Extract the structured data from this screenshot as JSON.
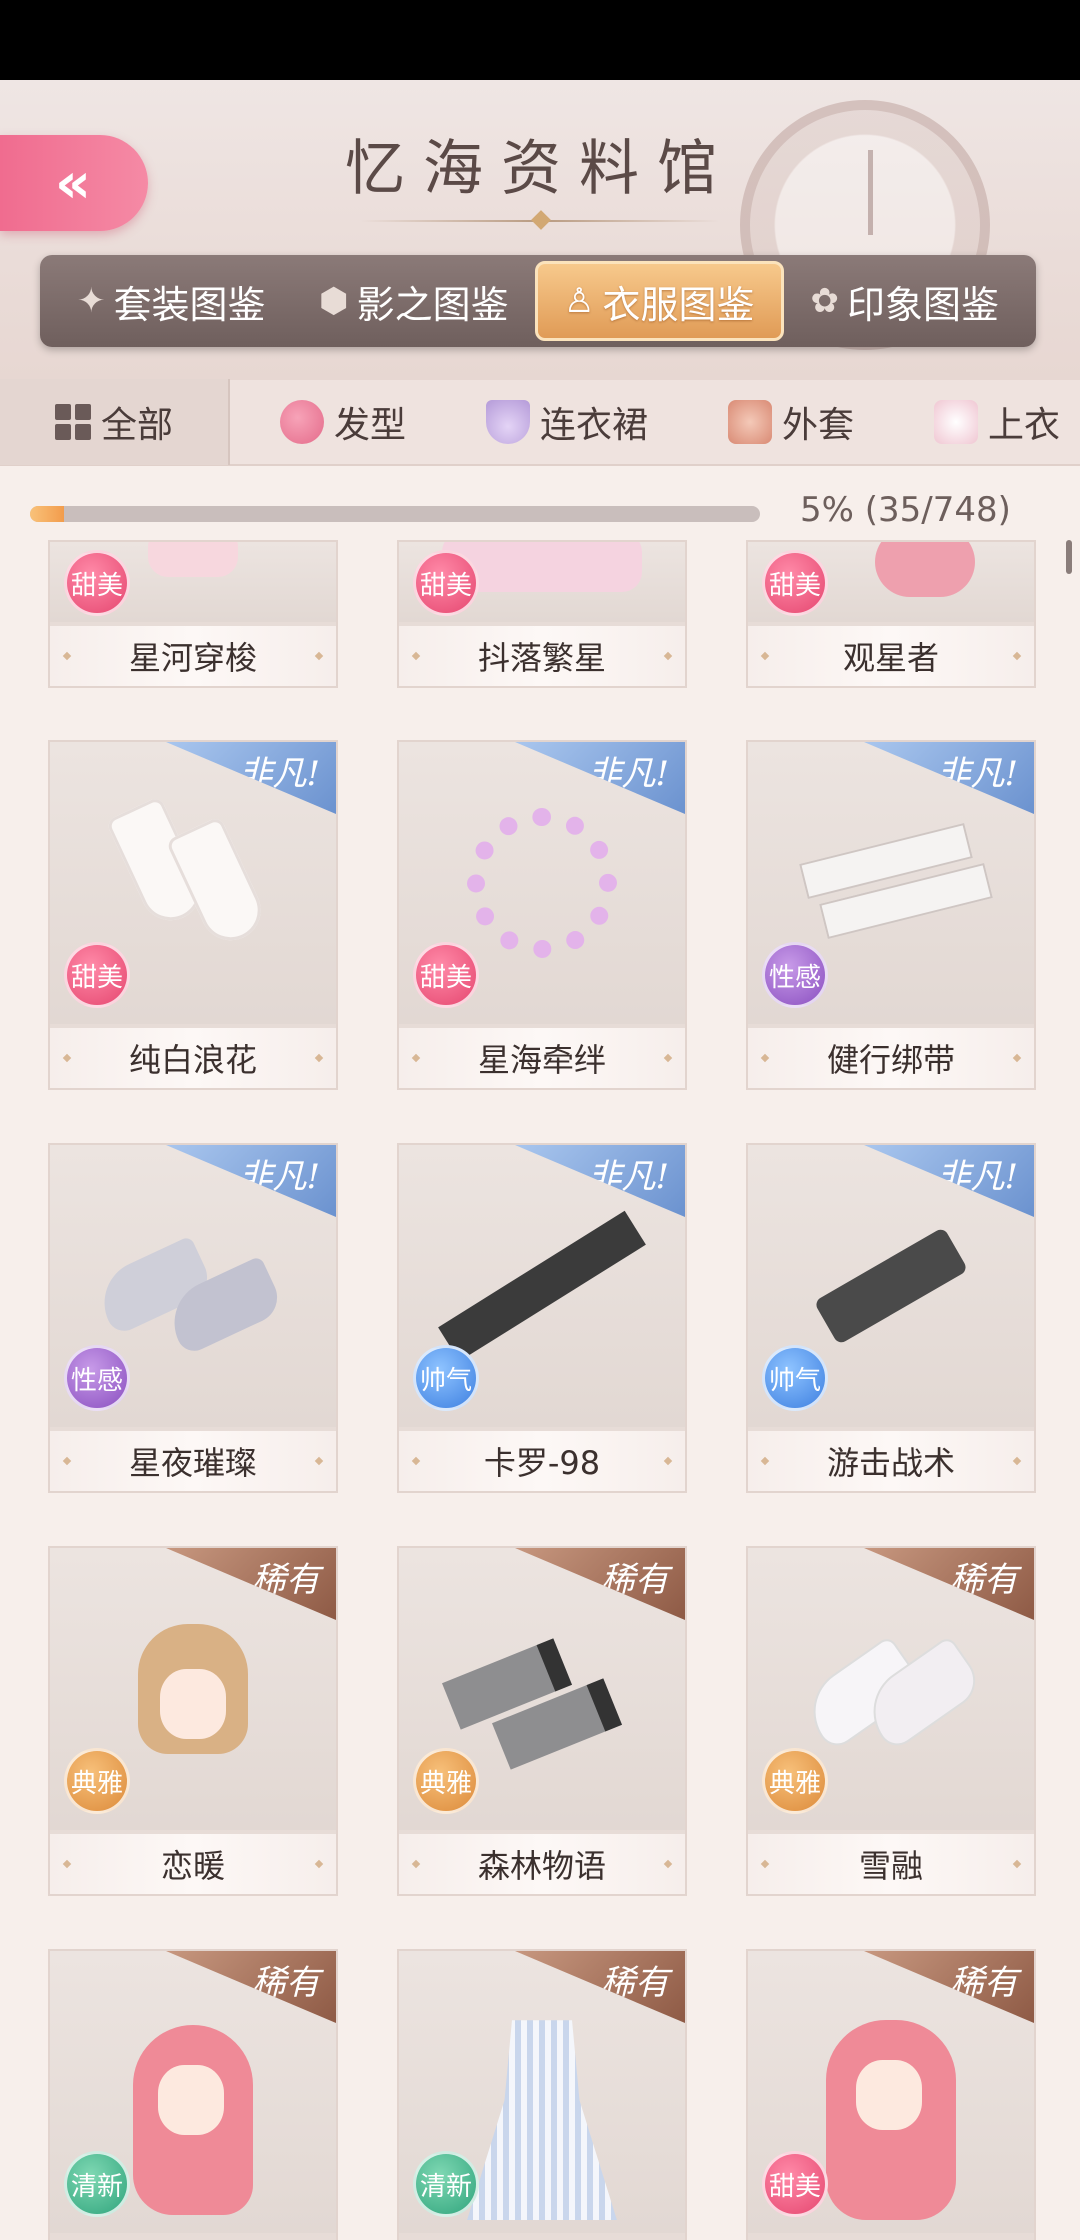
{
  "header": {
    "title": "忆海资料馆",
    "back_icon": "«"
  },
  "main_tabs": [
    {
      "label": "套装图鉴",
      "icon": "star-icon"
    },
    {
      "label": "影之图鉴",
      "icon": "gem-icon"
    },
    {
      "label": "衣服图鉴",
      "icon": "dress-icon",
      "active": true
    },
    {
      "label": "印象图鉴",
      "icon": "flower-icon"
    }
  ],
  "sub_tabs": [
    {
      "label": "全部",
      "icon": "grid-icon",
      "active": true
    },
    {
      "label": "发型",
      "icon": "hair-icon"
    },
    {
      "label": "连衣裙",
      "icon": "dress-icon"
    },
    {
      "label": "外套",
      "icon": "coat-icon"
    },
    {
      "label": "上衣",
      "icon": "shirt-icon"
    }
  ],
  "progress": {
    "text": "5% (35/748)",
    "fraction": 0.047
  },
  "items": [
    {
      "name": "星河穿梭",
      "tag": "甜美",
      "ribbon": ""
    },
    {
      "name": "抖落繁星",
      "tag": "甜美",
      "ribbon": ""
    },
    {
      "name": "观星者",
      "tag": "甜美",
      "ribbon": ""
    },
    {
      "name": "纯白浪花",
      "tag": "甜美",
      "ribbon": "非凡!"
    },
    {
      "name": "星海牵绊",
      "tag": "甜美",
      "ribbon": "非凡!"
    },
    {
      "name": "健行绑带",
      "tag": "性感",
      "ribbon": "非凡!"
    },
    {
      "name": "星夜璀璨",
      "tag": "性感",
      "ribbon": "非凡!"
    },
    {
      "name": "卡罗-98",
      "tag": "帅气",
      "ribbon": "非凡!"
    },
    {
      "name": "游击战术",
      "tag": "帅气",
      "ribbon": "非凡!"
    },
    {
      "name": "恋暖",
      "tag": "典雅",
      "ribbon": "稀有"
    },
    {
      "name": "森林物语",
      "tag": "典雅",
      "ribbon": "稀有"
    },
    {
      "name": "雪融",
      "tag": "典雅",
      "ribbon": "稀有"
    },
    {
      "name": "",
      "tag": "清新",
      "ribbon": "稀有"
    },
    {
      "name": "",
      "tag": "清新",
      "ribbon": "稀有"
    },
    {
      "name": "",
      "tag": "甜美",
      "ribbon": "稀有"
    }
  ],
  "colors": {
    "accent_pink": "#f06c8f",
    "active_tab_orange": "#e09b56",
    "progress_orange": "#f29c4c",
    "badge_sweet": "#e5466f",
    "badge_sexy": "#8a4fc0",
    "badge_cool": "#3d7fe0",
    "badge_elegant": "#dc8a3a",
    "badge_fresh": "#2fa47c"
  }
}
